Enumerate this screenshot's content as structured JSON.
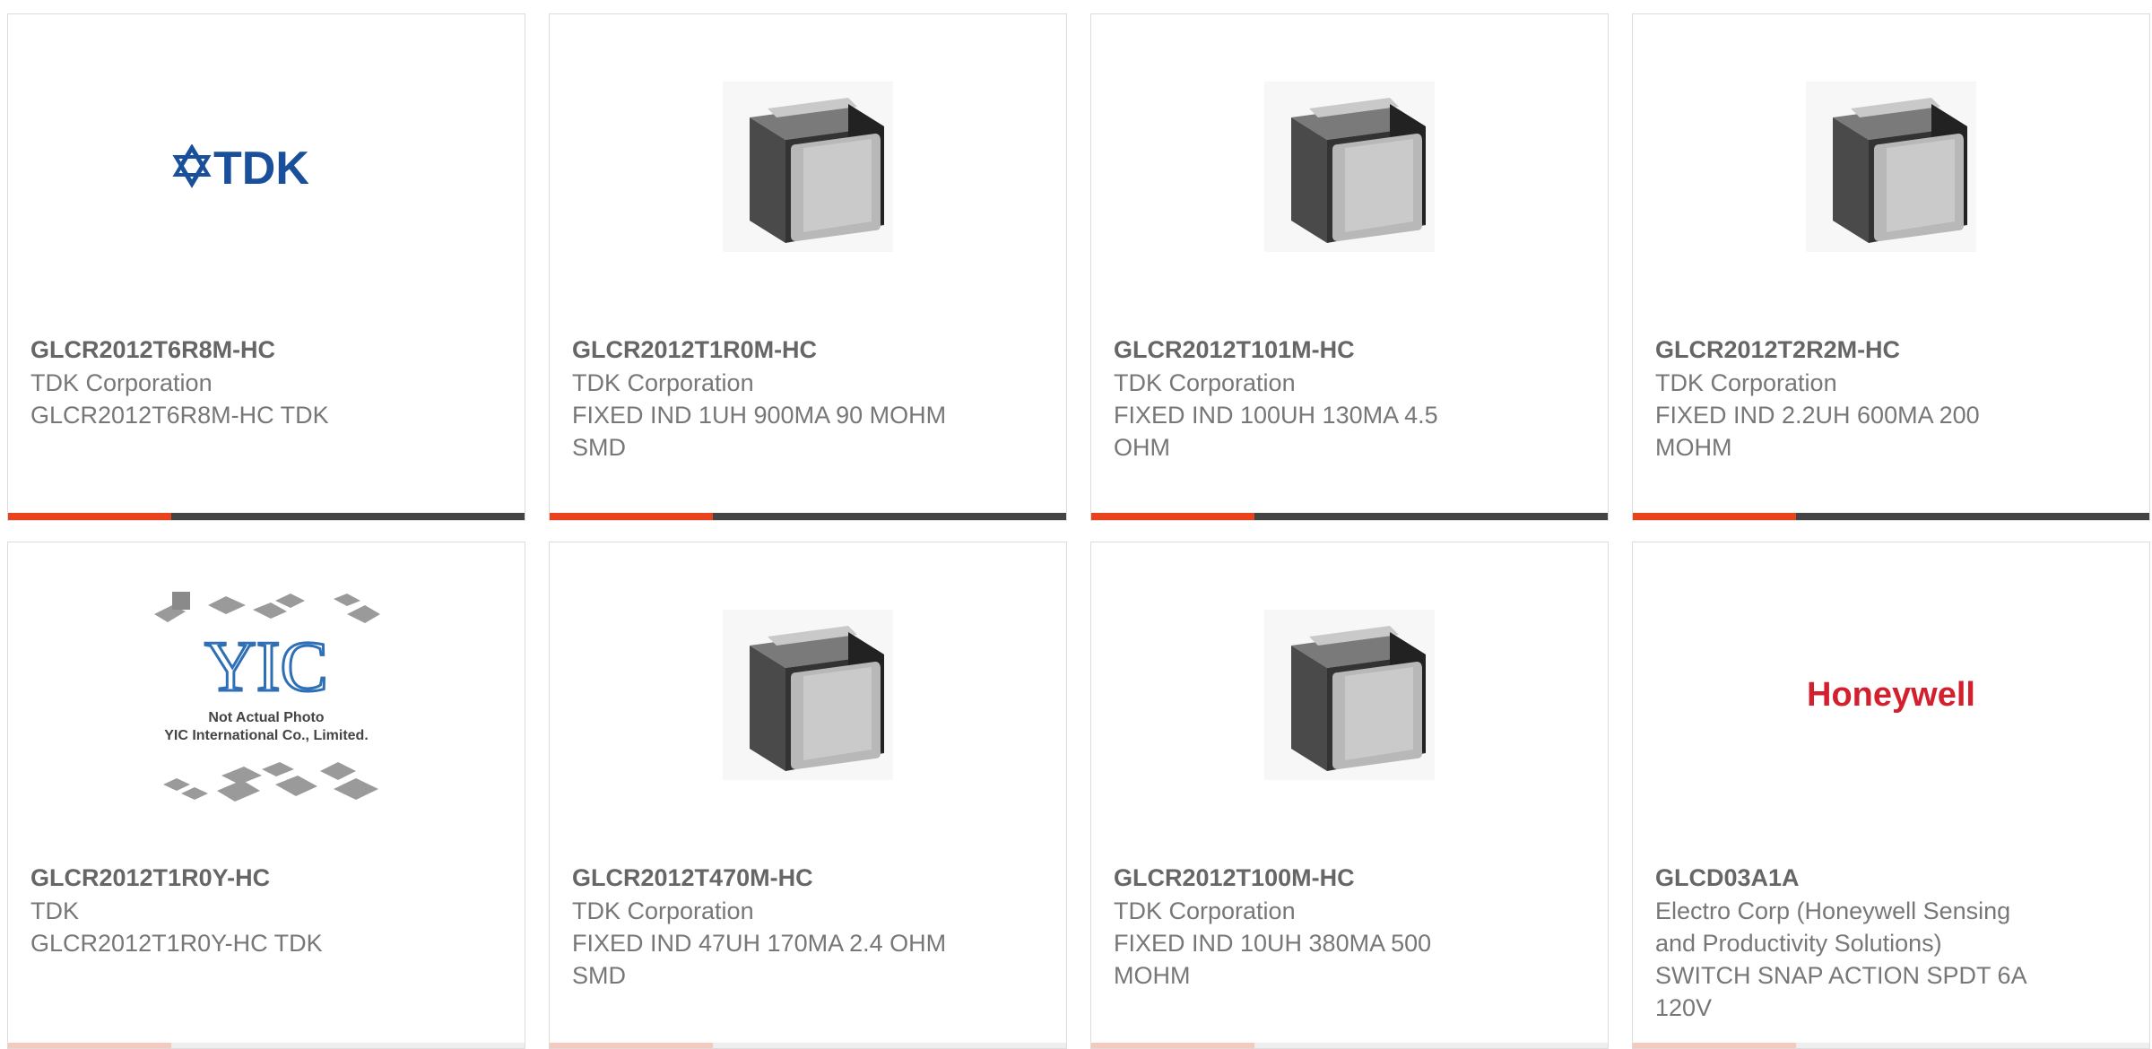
{
  "colors": {
    "accent": "#e8431c",
    "bar": "#444444",
    "border": "#dcdcdc",
    "text": "#666666"
  },
  "products": [
    {
      "part": "GLCR2012T6R8M-HC",
      "manufacturer": "TDK Corporation",
      "description": "GLCR2012T6R8M-HC TDK",
      "image": "tdk-logo",
      "logo_text": "TDK"
    },
    {
      "part": "GLCR2012T1R0M-HC",
      "manufacturer": "TDK Corporation",
      "description": "FIXED IND 1UH 900MA 90 MOHM SMD",
      "image": "smd-inductor-icon"
    },
    {
      "part": "GLCR2012T101M-HC",
      "manufacturer": "TDK Corporation",
      "description": "FIXED IND 100UH 130MA 4.5 OHM",
      "image": "smd-inductor-icon"
    },
    {
      "part": "GLCR2012T2R2M-HC",
      "manufacturer": "TDK Corporation",
      "description": "FIXED IND 2.2UH 600MA 200 MOHM",
      "image": "smd-inductor-icon"
    },
    {
      "part": "GLCR2012T1R0Y-HC",
      "manufacturer": "TDK",
      "description": "GLCR2012T1R0Y-HC TDK",
      "image": "not-actual-photo",
      "logo_text": "YIC",
      "photo_caption_1": "Not Actual Photo",
      "photo_caption_2": "YIC International Co., Limited."
    },
    {
      "part": "GLCR2012T470M-HC",
      "manufacturer": "TDK Corporation",
      "description": "FIXED IND 47UH 170MA 2.4 OHM SMD",
      "image": "smd-inductor-icon"
    },
    {
      "part": "GLCR2012T100M-HC",
      "manufacturer": "TDK Corporation",
      "description": "FIXED IND 10UH 380MA 500 MOHM",
      "image": "smd-inductor-icon"
    },
    {
      "part": "GLCD03A1A",
      "manufacturer": "Electro Corp (Honeywell Sensing and Productivity Solutions)",
      "description": "SWITCH SNAP ACTION SPDT 6A 120V",
      "image": "honeywell-logo",
      "logo_text": "Honeywell"
    }
  ]
}
